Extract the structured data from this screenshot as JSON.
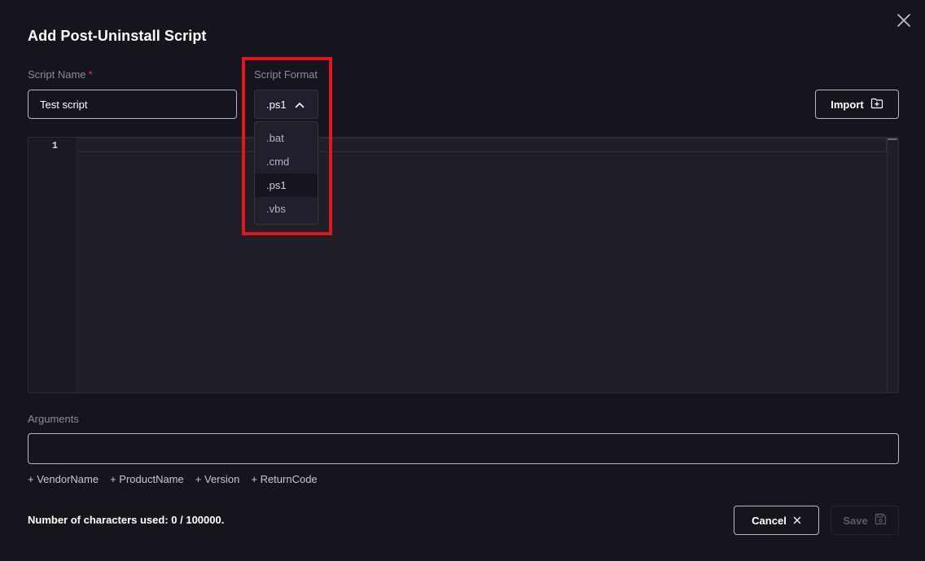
{
  "dialog": {
    "title": "Add Post-Uninstall Script"
  },
  "script_name": {
    "label": "Script Name",
    "required_mark": "*",
    "value": "Test script"
  },
  "script_format": {
    "label": "Script Format",
    "selected": ".ps1",
    "options": [
      ".bat",
      ".cmd",
      ".ps1",
      ".vbs"
    ]
  },
  "import_button": {
    "label": "Import",
    "icon": "folder-plus-icon"
  },
  "editor": {
    "line_numbers": [
      "1"
    ],
    "content": ""
  },
  "arguments": {
    "label": "Arguments",
    "value": "",
    "variables": [
      "+ VendorName",
      "+ ProductName",
      "+ Version",
      "+ ReturnCode"
    ]
  },
  "footer": {
    "char_count": "Number of characters used: 0 / 100000.",
    "cancel_label": "Cancel",
    "save_label": "Save"
  },
  "colors": {
    "background": "#16151e",
    "highlight": "#e0181b",
    "required": "#e23d3d"
  }
}
